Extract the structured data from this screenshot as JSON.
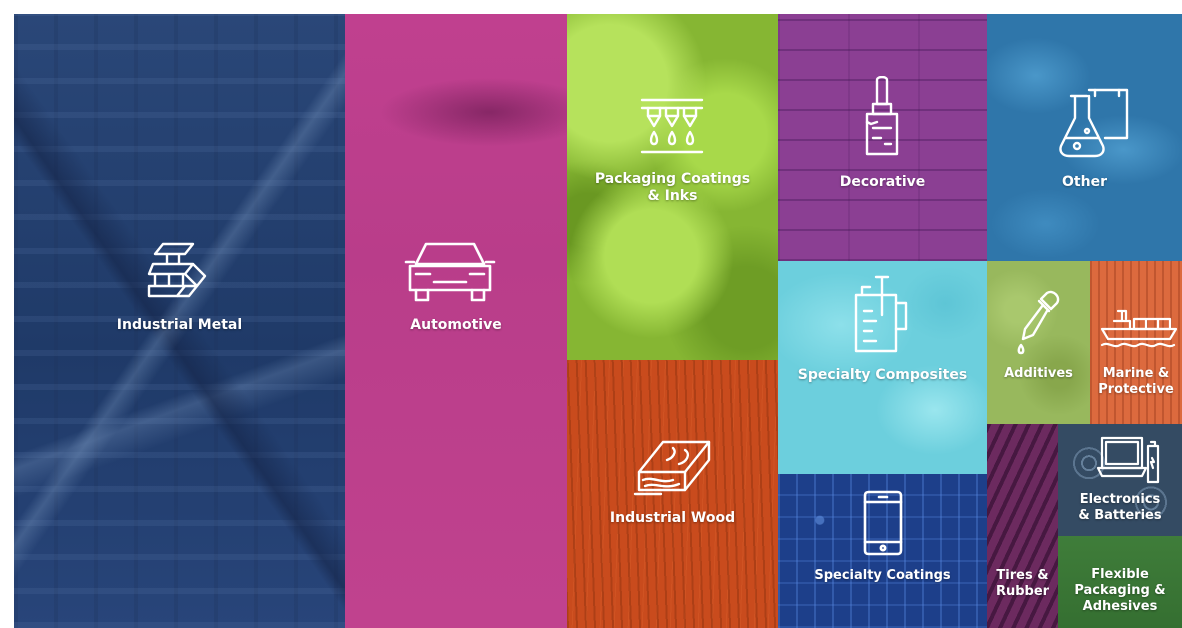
{
  "tiles": {
    "industrial_metal": "Industrial Metal",
    "automotive": "Automotive",
    "packaging": "Packaging Coatings\n& Inks",
    "decorative": "Decorative",
    "other": "Other",
    "industrial_wood": "Industrial Wood",
    "specialty_composites": "Specialty Composites",
    "additives": "Additives",
    "marine": "Marine &\nProtective",
    "specialty_coatings": "Specialty Coatings",
    "tires": "Tires &\nRubber",
    "electronics": "Electronics\n& Batteries",
    "flexible": "Flexible\nPackaging &\nAdhesives"
  },
  "icons": {
    "industrial_metal": "metal-beams-icon",
    "automotive": "car-icon",
    "packaging": "nozzles-drops-icon",
    "decorative": "paintbrush-icon",
    "other": "flask-bags-icon",
    "industrial_wood": "wood-planks-icon",
    "specialty_composites": "measuring-jug-icon",
    "additives": "dropper-icon",
    "marine": "ship-icon",
    "specialty_coatings": "smartphone-icon",
    "electronics": "laptop-battery-icon"
  },
  "colors": {
    "industrial_metal": "#1f3a68",
    "automotive": "#bf3e8c",
    "packaging": "#86b633",
    "decorative": "#8b3f93",
    "other": "#2f76aa",
    "industrial_wood": "#c94b1d",
    "specialty_composites": "#6ccfdd",
    "additives": "#98b85d",
    "marine": "#dc6a3e",
    "specialty_coatings": "#1d3f8a",
    "tires": "#6c2a5f",
    "electronics": "#344b63",
    "flexible": "#3f7d3a"
  }
}
